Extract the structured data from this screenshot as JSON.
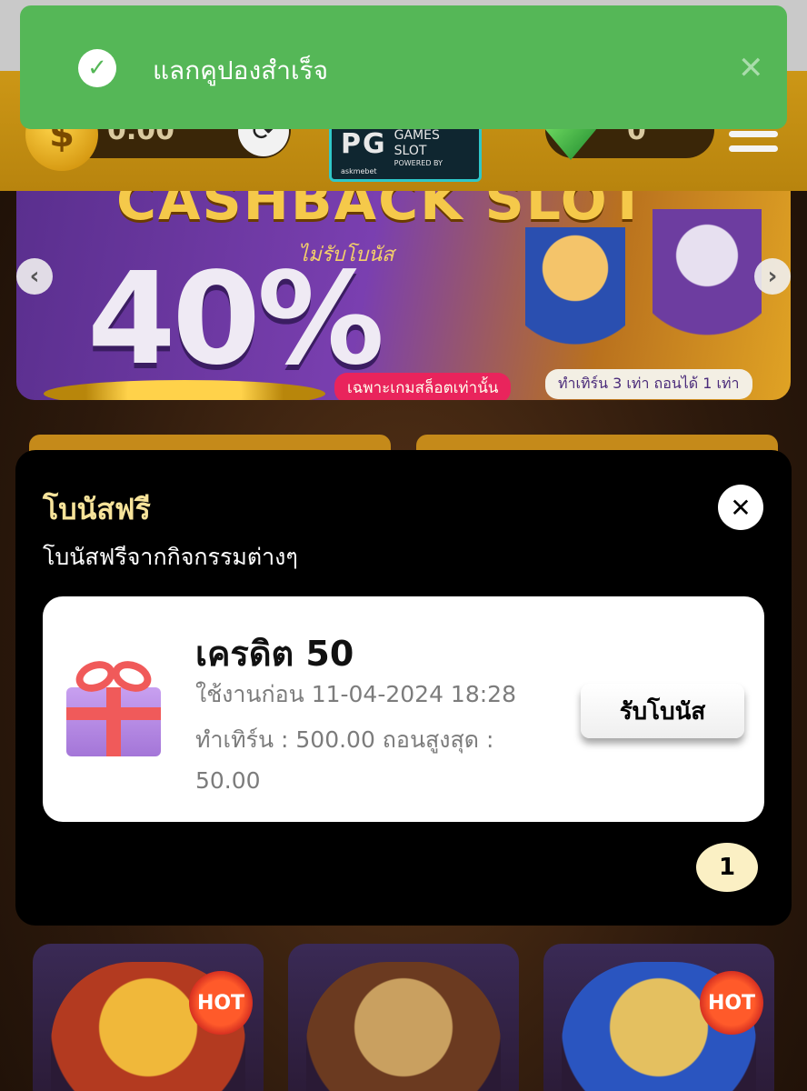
{
  "toast": {
    "message": "แลกคูปองสำเร็จ",
    "check_icon": "check-circle-icon",
    "close_icon": "close-icon",
    "color": "#55b757"
  },
  "header": {
    "balance": "0.00",
    "gem_count": "0",
    "logo_text": "PG",
    "logo_sub": "GAMES SLOT",
    "logo_powered": "POWERED BY",
    "logo_brand": "askmebet"
  },
  "banner": {
    "title": "CASHBACK SLOT",
    "subtitle": "ไม่รับโบนัส",
    "percent": "40%",
    "tag_left": "เฉพาะเกมสล็อตเท่านั้น",
    "tag_right": "ทำเทิร์น 3 เท่า ถอนได้ 1 เท่า"
  },
  "modal": {
    "title": "โบนัสฟรี",
    "subtitle": "โบนัสฟรีจากกิจกรรมต่างๆ",
    "title_color": "#f6e39a",
    "bonus": {
      "credit": "เครดิต 50",
      "expiry": "ใช้งานก่อน 11-04-2024 18:28",
      "turnover": "ทำเทิร์น : 500.00  ถอนสูงสุด :",
      "max_withdraw": "50.00",
      "claim_label": "รับโบนัส",
      "icon": "gift-icon"
    },
    "page": "1"
  },
  "games": {
    "hot_label": "HOT"
  }
}
